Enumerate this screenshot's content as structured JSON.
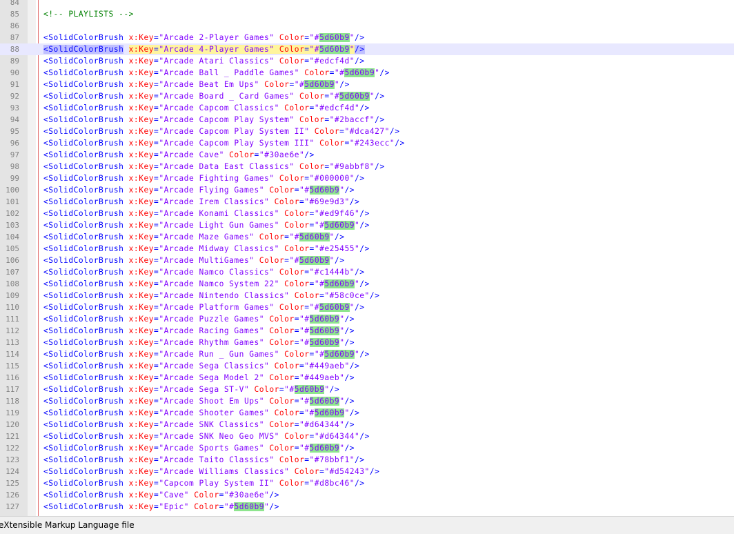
{
  "colors": {
    "tag": "#0000ff",
    "attribute": "#ff0000",
    "value": "#8000ff",
    "comment": "#008000",
    "find_highlight": "#8ee58e",
    "selection": "#c0c0ff",
    "current_line": "#e8e8ff"
  },
  "editor": {
    "current_line": 88,
    "highlight_term": "5d60b9",
    "lines": [
      {
        "num": "84",
        "kind": "blank",
        "text": ""
      },
      {
        "num": "85",
        "kind": "comment",
        "text": "<!-- PLAYLISTS -->"
      },
      {
        "num": "86",
        "kind": "blank",
        "text": ""
      },
      {
        "num": "87",
        "kind": "brush",
        "key": "Arcade 2-Player Games",
        "color": "#5d60b9"
      },
      {
        "num": "88",
        "kind": "brush",
        "key": "Arcade 4-Player Games",
        "color": "#5d60b9"
      },
      {
        "num": "89",
        "kind": "brush",
        "key": "Arcade Atari Classics",
        "color": "#edcf4d"
      },
      {
        "num": "90",
        "kind": "brush",
        "key": "Arcade Ball _ Paddle Games",
        "color": "#5d60b9"
      },
      {
        "num": "91",
        "kind": "brush",
        "key": "Arcade Beat Em Ups",
        "color": "#5d60b9"
      },
      {
        "num": "92",
        "kind": "brush",
        "key": "Arcade Board _ Card Games",
        "color": "#5d60b9"
      },
      {
        "num": "93",
        "kind": "brush",
        "key": "Arcade Capcom Classics",
        "color": "#edcf4d"
      },
      {
        "num": "94",
        "kind": "brush",
        "key": "Arcade Capcom Play System",
        "color": "#2baccf"
      },
      {
        "num": "95",
        "kind": "brush",
        "key": "Arcade Capcom Play System II",
        "color": "#dca427"
      },
      {
        "num": "96",
        "kind": "brush",
        "key": "Arcade Capcom Play System III",
        "color": "#243ecc"
      },
      {
        "num": "97",
        "kind": "brush",
        "key": "Arcade Cave",
        "color": "#30ae6e"
      },
      {
        "num": "98",
        "kind": "brush",
        "key": "Arcade Data East Classics",
        "color": "#9abbf8"
      },
      {
        "num": "99",
        "kind": "brush",
        "key": "Arcade Fighting Games",
        "color": "#000000"
      },
      {
        "num": "100",
        "kind": "brush",
        "key": "Arcade Flying Games",
        "color": "#5d60b9"
      },
      {
        "num": "101",
        "kind": "brush",
        "key": "Arcade Irem Classics",
        "color": "#69e9d3"
      },
      {
        "num": "102",
        "kind": "brush",
        "key": "Arcade Konami Classics",
        "color": "#ed9f46"
      },
      {
        "num": "103",
        "kind": "brush",
        "key": "Arcade Light Gun Games",
        "color": "#5d60b9"
      },
      {
        "num": "104",
        "kind": "brush",
        "key": "Arcade Maze Games",
        "color": "#5d60b9"
      },
      {
        "num": "105",
        "kind": "brush",
        "key": "Arcade Midway Classics",
        "color": "#e25455"
      },
      {
        "num": "106",
        "kind": "brush",
        "key": "Arcade MultiGames",
        "color": "#5d60b9"
      },
      {
        "num": "107",
        "kind": "brush",
        "key": "Arcade Namco Classics",
        "color": "#c1444b"
      },
      {
        "num": "108",
        "kind": "brush",
        "key": "Arcade Namco System 22",
        "color": "#5d60b9"
      },
      {
        "num": "109",
        "kind": "brush",
        "key": "Arcade Nintendo Classics",
        "color": "#58c0ce"
      },
      {
        "num": "110",
        "kind": "brush",
        "key": "Arcade Platform Games",
        "color": "#5d60b9"
      },
      {
        "num": "111",
        "kind": "brush",
        "key": "Arcade Puzzle Games",
        "color": "#5d60b9"
      },
      {
        "num": "112",
        "kind": "brush",
        "key": "Arcade Racing Games",
        "color": "#5d60b9"
      },
      {
        "num": "113",
        "kind": "brush",
        "key": "Arcade Rhythm Games",
        "color": "#5d60b9"
      },
      {
        "num": "114",
        "kind": "brush",
        "key": "Arcade Run _ Gun Games",
        "color": "#5d60b9"
      },
      {
        "num": "115",
        "kind": "brush",
        "key": "Arcade Sega Classics",
        "color": "#449aeb"
      },
      {
        "num": "116",
        "kind": "brush",
        "key": "Arcade Sega Model 2",
        "color": "#449aeb"
      },
      {
        "num": "117",
        "kind": "brush",
        "key": "Arcade Sega ST-V",
        "color": "#5d60b9"
      },
      {
        "num": "118",
        "kind": "brush",
        "key": "Arcade Shoot Em Ups",
        "color": "#5d60b9"
      },
      {
        "num": "119",
        "kind": "brush",
        "key": "Arcade Shooter Games",
        "color": "#5d60b9"
      },
      {
        "num": "120",
        "kind": "brush",
        "key": "Arcade SNK Classics",
        "color": "#d64344"
      },
      {
        "num": "121",
        "kind": "brush",
        "key": "Arcade SNK Neo Geo MVS",
        "color": "#d64344"
      },
      {
        "num": "122",
        "kind": "brush",
        "key": "Arcade Sports Games",
        "color": "#5d60b9"
      },
      {
        "num": "123",
        "kind": "brush",
        "key": "Arcade Taito Classics",
        "color": "#78bbf1"
      },
      {
        "num": "124",
        "kind": "brush",
        "key": "Arcade Williams Classics",
        "color": "#d54243"
      },
      {
        "num": "125",
        "kind": "brush",
        "key": "Capcom Play System II",
        "color": "#d8bc46"
      },
      {
        "num": "126",
        "kind": "brush",
        "key": "Cave",
        "color": "#30ae6e"
      },
      {
        "num": "127",
        "kind": "brush",
        "key": "Epic",
        "color": "#5d60b9"
      }
    ]
  },
  "syntax": {
    "tag_open": "<SolidColorBrush",
    "key_attr": "x:Key",
    "color_attr": "Color",
    "tag_close": "/>"
  },
  "statusbar": {
    "file_type": "eXtensible Markup Language file"
  }
}
